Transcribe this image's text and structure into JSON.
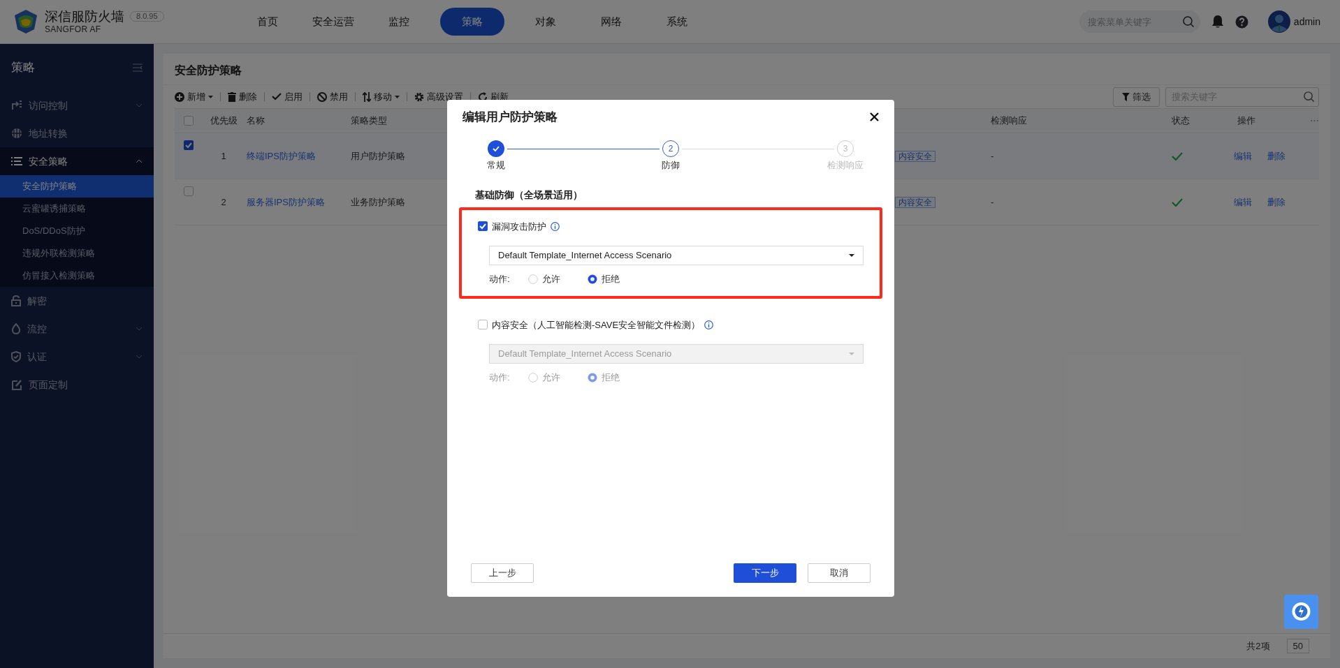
{
  "header": {
    "brand": "深信服防火墙",
    "version": "8.0.95",
    "subtitle": "SANGFOR AF",
    "search_placeholder": "搜索菜单关键字",
    "user": "admin",
    "nav": [
      {
        "label": "首页",
        "selected": false
      },
      {
        "label": "安全运营",
        "selected": false
      },
      {
        "label": "监控",
        "selected": false
      },
      {
        "label": "策略",
        "selected": true
      },
      {
        "label": "对象",
        "selected": false
      },
      {
        "label": "网络",
        "selected": false
      },
      {
        "label": "系统",
        "selected": false
      }
    ]
  },
  "sidebar": {
    "title": "策略",
    "items": [
      {
        "label": "访问控制",
        "expandable": true,
        "expanded": false
      },
      {
        "label": "地址转换",
        "expandable": false,
        "expanded": false
      },
      {
        "label": "安全策略",
        "expandable": true,
        "expanded": true,
        "children": [
          {
            "label": "安全防护策略",
            "selected": true
          },
          {
            "label": "云蜜罐诱捕策略",
            "selected": false
          },
          {
            "label": "DoS/DDoS防护",
            "selected": false
          },
          {
            "label": "违规外联检测策略",
            "selected": false
          },
          {
            "label": "仿冒接入检测策略",
            "selected": false
          }
        ]
      },
      {
        "label": "解密",
        "expandable": false,
        "expanded": false
      },
      {
        "label": "流控",
        "expandable": true,
        "expanded": false
      },
      {
        "label": "认证",
        "expandable": true,
        "expanded": false
      },
      {
        "label": "页面定制",
        "expandable": false,
        "expanded": false
      }
    ]
  },
  "page_title": "安全防护策略",
  "toolbar": [
    {
      "label": "新增",
      "dropdown": true
    },
    {
      "label": "删除",
      "dropdown": false
    },
    {
      "label": "启用",
      "dropdown": false
    },
    {
      "label": "禁用",
      "dropdown": false
    },
    {
      "label": "移动",
      "dropdown": true
    },
    {
      "label": "高级设置",
      "dropdown": false
    },
    {
      "label": "刷新",
      "dropdown": false
    }
  ],
  "filter_button": "筛选",
  "table_search_placeholder": "搜索关键字",
  "table": {
    "select_all": false,
    "more_columns": "⋯",
    "columns": {
      "priority": "优先级",
      "name": "名称",
      "type": "策略类型",
      "response": "检测响应",
      "status": "状态",
      "actions": "操作"
    },
    "rows": [
      {
        "checked": true,
        "priority": "1",
        "name": "终端IPS防护策略",
        "type": "用户防护策略",
        "tag": "内容安全",
        "response": "-",
        "enabled": true,
        "actions": [
          "编辑",
          "删除"
        ]
      },
      {
        "checked": false,
        "priority": "2",
        "name": "服务器IPS防护策略",
        "type": "业务防护策略",
        "tag": "内容安全",
        "response": "-",
        "enabled": true,
        "actions": [
          "编辑",
          "删除"
        ]
      }
    ]
  },
  "pagination": {
    "total": "共2项",
    "page_size": "50"
  },
  "modal": {
    "title": "编辑用户防护策略",
    "steps": [
      {
        "label": "常规",
        "completed": true,
        "active": false
      },
      {
        "label": "防御",
        "number": "2",
        "completed": false,
        "active": true
      },
      {
        "label": "检测响应",
        "number": "3",
        "completed": false,
        "active": false
      }
    ],
    "section_title": "基础防御（全场景适用）",
    "options": [
      {
        "label": "漏洞攻击防护",
        "checked": true,
        "highlighted": true,
        "template": "Default Template_Internet Access Scenario",
        "action_label": "动作:",
        "actions": [
          {
            "label": "允许",
            "selected": false
          },
          {
            "label": "拒绝",
            "selected": true
          }
        ]
      },
      {
        "label": "内容安全（人工智能检测-SAVE安全智能文件检测）",
        "checked": false,
        "highlighted": false,
        "template": "Default Template_Internet Access Scenario",
        "action_label": "动作:",
        "actions": [
          {
            "label": "允许",
            "selected": false
          },
          {
            "label": "拒绝",
            "selected": true
          }
        ]
      }
    ],
    "buttons": {
      "prev": "上一步",
      "next": "下一步",
      "cancel": "取消"
    }
  }
}
